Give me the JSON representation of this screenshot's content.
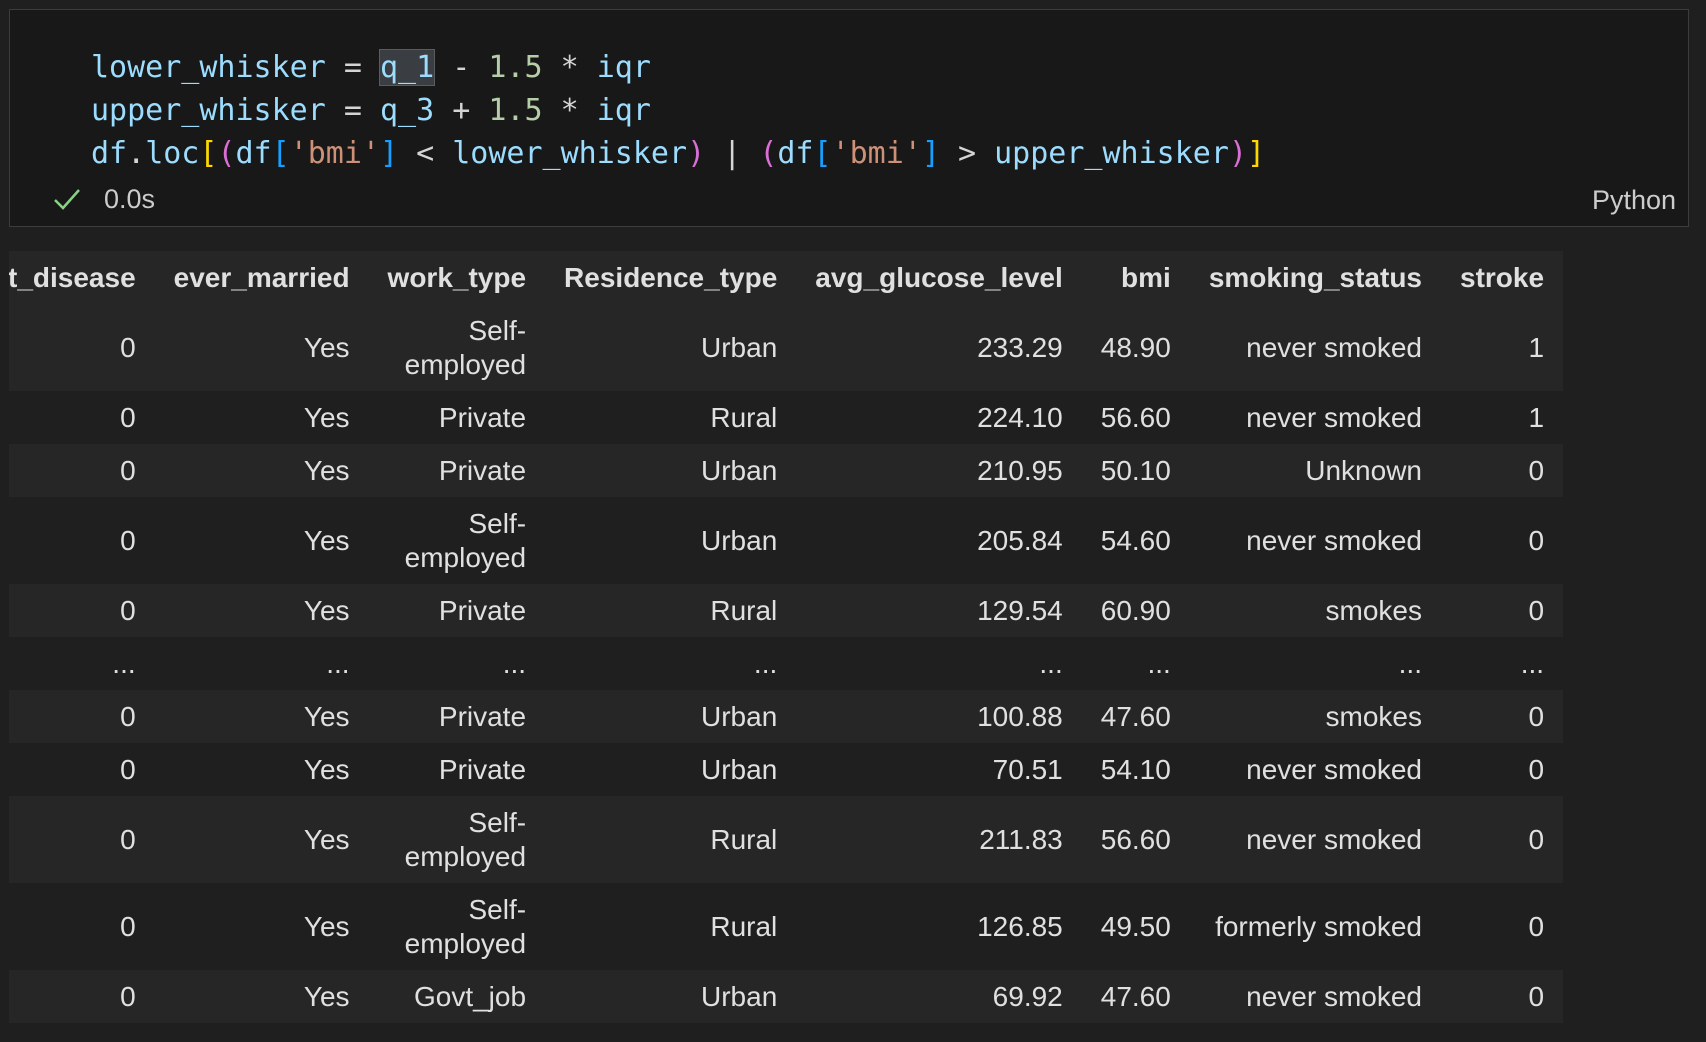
{
  "cell": {
    "code_lines": [
      [
        {
          "t": "lower_whisker",
          "c": "tok-var"
        },
        {
          "t": " = ",
          "c": "tok-op"
        },
        {
          "t": "q_1",
          "c": "tok-var tok-sel"
        },
        {
          "t": " - ",
          "c": "tok-op"
        },
        {
          "t": "1.5",
          "c": "tok-num"
        },
        {
          "t": " * ",
          "c": "tok-op"
        },
        {
          "t": "iqr",
          "c": "tok-var"
        }
      ],
      [
        {
          "t": "upper_whisker",
          "c": "tok-var"
        },
        {
          "t": " = ",
          "c": "tok-op"
        },
        {
          "t": "q_3",
          "c": "tok-var"
        },
        {
          "t": " + ",
          "c": "tok-op"
        },
        {
          "t": "1.5",
          "c": "tok-num"
        },
        {
          "t": " * ",
          "c": "tok-op"
        },
        {
          "t": "iqr",
          "c": "tok-var"
        }
      ],
      [
        {
          "t": "df",
          "c": "tok-var"
        },
        {
          "t": ".",
          "c": "tok-op"
        },
        {
          "t": "loc",
          "c": "tok-var"
        },
        {
          "t": "[",
          "c": "tok-br1"
        },
        {
          "t": "(",
          "c": "tok-br2"
        },
        {
          "t": "df",
          "c": "tok-var"
        },
        {
          "t": "[",
          "c": "tok-br3"
        },
        {
          "t": "'bmi'",
          "c": "tok-str"
        },
        {
          "t": "]",
          "c": "tok-br3"
        },
        {
          "t": " < ",
          "c": "tok-op"
        },
        {
          "t": "lower_whisker",
          "c": "tok-var"
        },
        {
          "t": ")",
          "c": "tok-br2"
        },
        {
          "t": " | ",
          "c": "tok-op"
        },
        {
          "t": "(",
          "c": "tok-br2"
        },
        {
          "t": "df",
          "c": "tok-var"
        },
        {
          "t": "[",
          "c": "tok-br3"
        },
        {
          "t": "'bmi'",
          "c": "tok-str"
        },
        {
          "t": "]",
          "c": "tok-br3"
        },
        {
          "t": " > ",
          "c": "tok-op"
        },
        {
          "t": "upper_whisker",
          "c": "tok-var"
        },
        {
          "t": ")",
          "c": "tok-br2"
        },
        {
          "t": "]",
          "c": "tok-br1"
        }
      ]
    ],
    "exec_time": "0.0s",
    "status_icon": "check-icon",
    "status_color": "#89d185",
    "language": "Python"
  },
  "table": {
    "columns": [
      "t_disease",
      "ever_married",
      "work_type",
      "Residence_type",
      "avg_glucose_level",
      "bmi",
      "smoking_status",
      "stroke"
    ],
    "rows": [
      [
        "0",
        "Yes",
        "Self-employed",
        "Urban",
        "233.29",
        "48.90",
        "never smoked",
        "1"
      ],
      [
        "0",
        "Yes",
        "Private",
        "Rural",
        "224.10",
        "56.60",
        "never smoked",
        "1"
      ],
      [
        "0",
        "Yes",
        "Private",
        "Urban",
        "210.95",
        "50.10",
        "Unknown",
        "0"
      ],
      [
        "0",
        "Yes",
        "Self-employed",
        "Urban",
        "205.84",
        "54.60",
        "never smoked",
        "0"
      ],
      [
        "0",
        "Yes",
        "Private",
        "Rural",
        "129.54",
        "60.90",
        "smokes",
        "0"
      ],
      [
        "...",
        "...",
        "...",
        "...",
        "...",
        "...",
        "...",
        "..."
      ],
      [
        "0",
        "Yes",
        "Private",
        "Urban",
        "100.88",
        "47.60",
        "smokes",
        "0"
      ],
      [
        "0",
        "Yes",
        "Private",
        "Urban",
        "70.51",
        "54.10",
        "never smoked",
        "0"
      ],
      [
        "0",
        "Yes",
        "Self-employed",
        "Rural",
        "211.83",
        "56.60",
        "never smoked",
        "0"
      ],
      [
        "0",
        "Yes",
        "Self-employed",
        "Rural",
        "126.85",
        "49.50",
        "formerly smoked",
        "0"
      ],
      [
        "0",
        "Yes",
        "Govt_job",
        "Urban",
        "69.92",
        "47.60",
        "never smoked",
        "0"
      ]
    ]
  }
}
